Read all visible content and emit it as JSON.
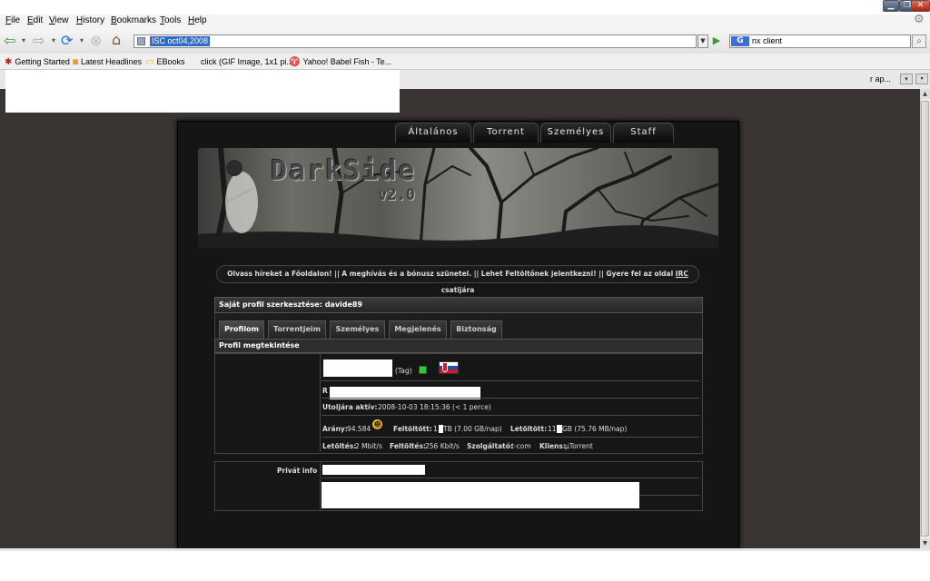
{
  "window": {
    "minimize": "▁",
    "maximize": "❐",
    "close": "✕"
  },
  "menu": [
    "File",
    "Edit",
    "View",
    "History",
    "Bookmarks",
    "Tools",
    "Help"
  ],
  "navbar": {
    "url": "ISC oct04,2008",
    "search_engine": "G",
    "search_value": "nx client"
  },
  "bookmarks": [
    {
      "icon": "spider-icon",
      "label": "Getting Started"
    },
    {
      "icon": "rss-icon",
      "label": "Latest Headlines"
    },
    {
      "icon": "folder-icon",
      "label": "EBooks"
    },
    {
      "icon": "image-icon",
      "label": "click (GIF Image, 1x1 pi..."
    },
    {
      "icon": "babelfish-icon",
      "label": "Yahoo! Babel Fish - Te..."
    }
  ],
  "tabs": {
    "partial_title": "r ap..."
  },
  "site": {
    "nav": [
      "Általános",
      "Torrent",
      "Személyes",
      "Staff"
    ],
    "banner": {
      "title": "DarkSide",
      "version": "v2.0"
    },
    "news": {
      "text": "Olvass híreket a Főoldalon! || A meghívás és a bónusz szünetel. || Lehet Feltöltőnek jelentkezni! || Gyere fel az oldal ",
      "irc": "IRC",
      "suffix": " csatijára"
    },
    "profile_header": "Saját profil szerkesztése: davide89",
    "profile_tabs": [
      "Profilom",
      "Torrentjeim",
      "Személyes",
      "Megjelenés",
      "Biztonság"
    ],
    "overview_header": "Profil megtekintése",
    "user_class": "(Tag)",
    "row2_prefix": "R",
    "last_active_label": "Utoljára aktív:",
    "last_active_value": "2008-10-03 18:15:36 (< 1 perce)",
    "ratio_label": "Arány:",
    "ratio_value": "94.584",
    "uploaded_label": "Feltöltött:",
    "uploaded_value_a": "1.",
    "uploaded_value_b": " TB (7.00 GB/nap)",
    "downloaded_label": "Letöltött:",
    "downloaded_value_a": "11.",
    "downloaded_value_b": " GB (75.76 MB/nap)",
    "dl_speed_label": "Letöltés:",
    "dl_speed_value": "2 Mbit/s",
    "ul_speed_label": "Feltöltés:",
    "ul_speed_value": "256 Kbit/s",
    "isp_label": "Szolgáltató:",
    "isp_value": "t-com",
    "client_label": "Kliens:",
    "client_value": "µTorrent",
    "private_info_label": "Privát info"
  }
}
